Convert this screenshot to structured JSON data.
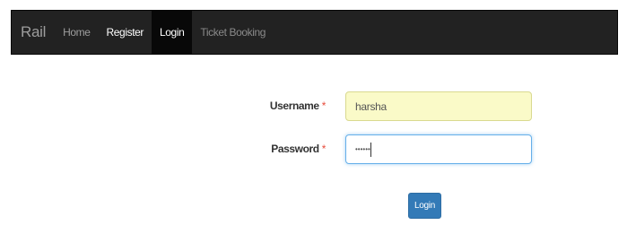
{
  "navbar": {
    "brand": "Rail",
    "items": [
      {
        "label": "Home"
      },
      {
        "label": "Register"
      },
      {
        "label": "Login"
      },
      {
        "label": "Ticket Booking"
      }
    ]
  },
  "form": {
    "username": {
      "label": "Username",
      "required_mark": "*",
      "value": "harsha"
    },
    "password": {
      "label": "Password",
      "required_mark": "*",
      "value": "••••••"
    },
    "submit_label": "Login"
  },
  "colors": {
    "navbar_bg": "#222222",
    "primary_button": "#337ab7",
    "autofill_bg": "#fafac8",
    "required_mark": "#e74c3c"
  }
}
